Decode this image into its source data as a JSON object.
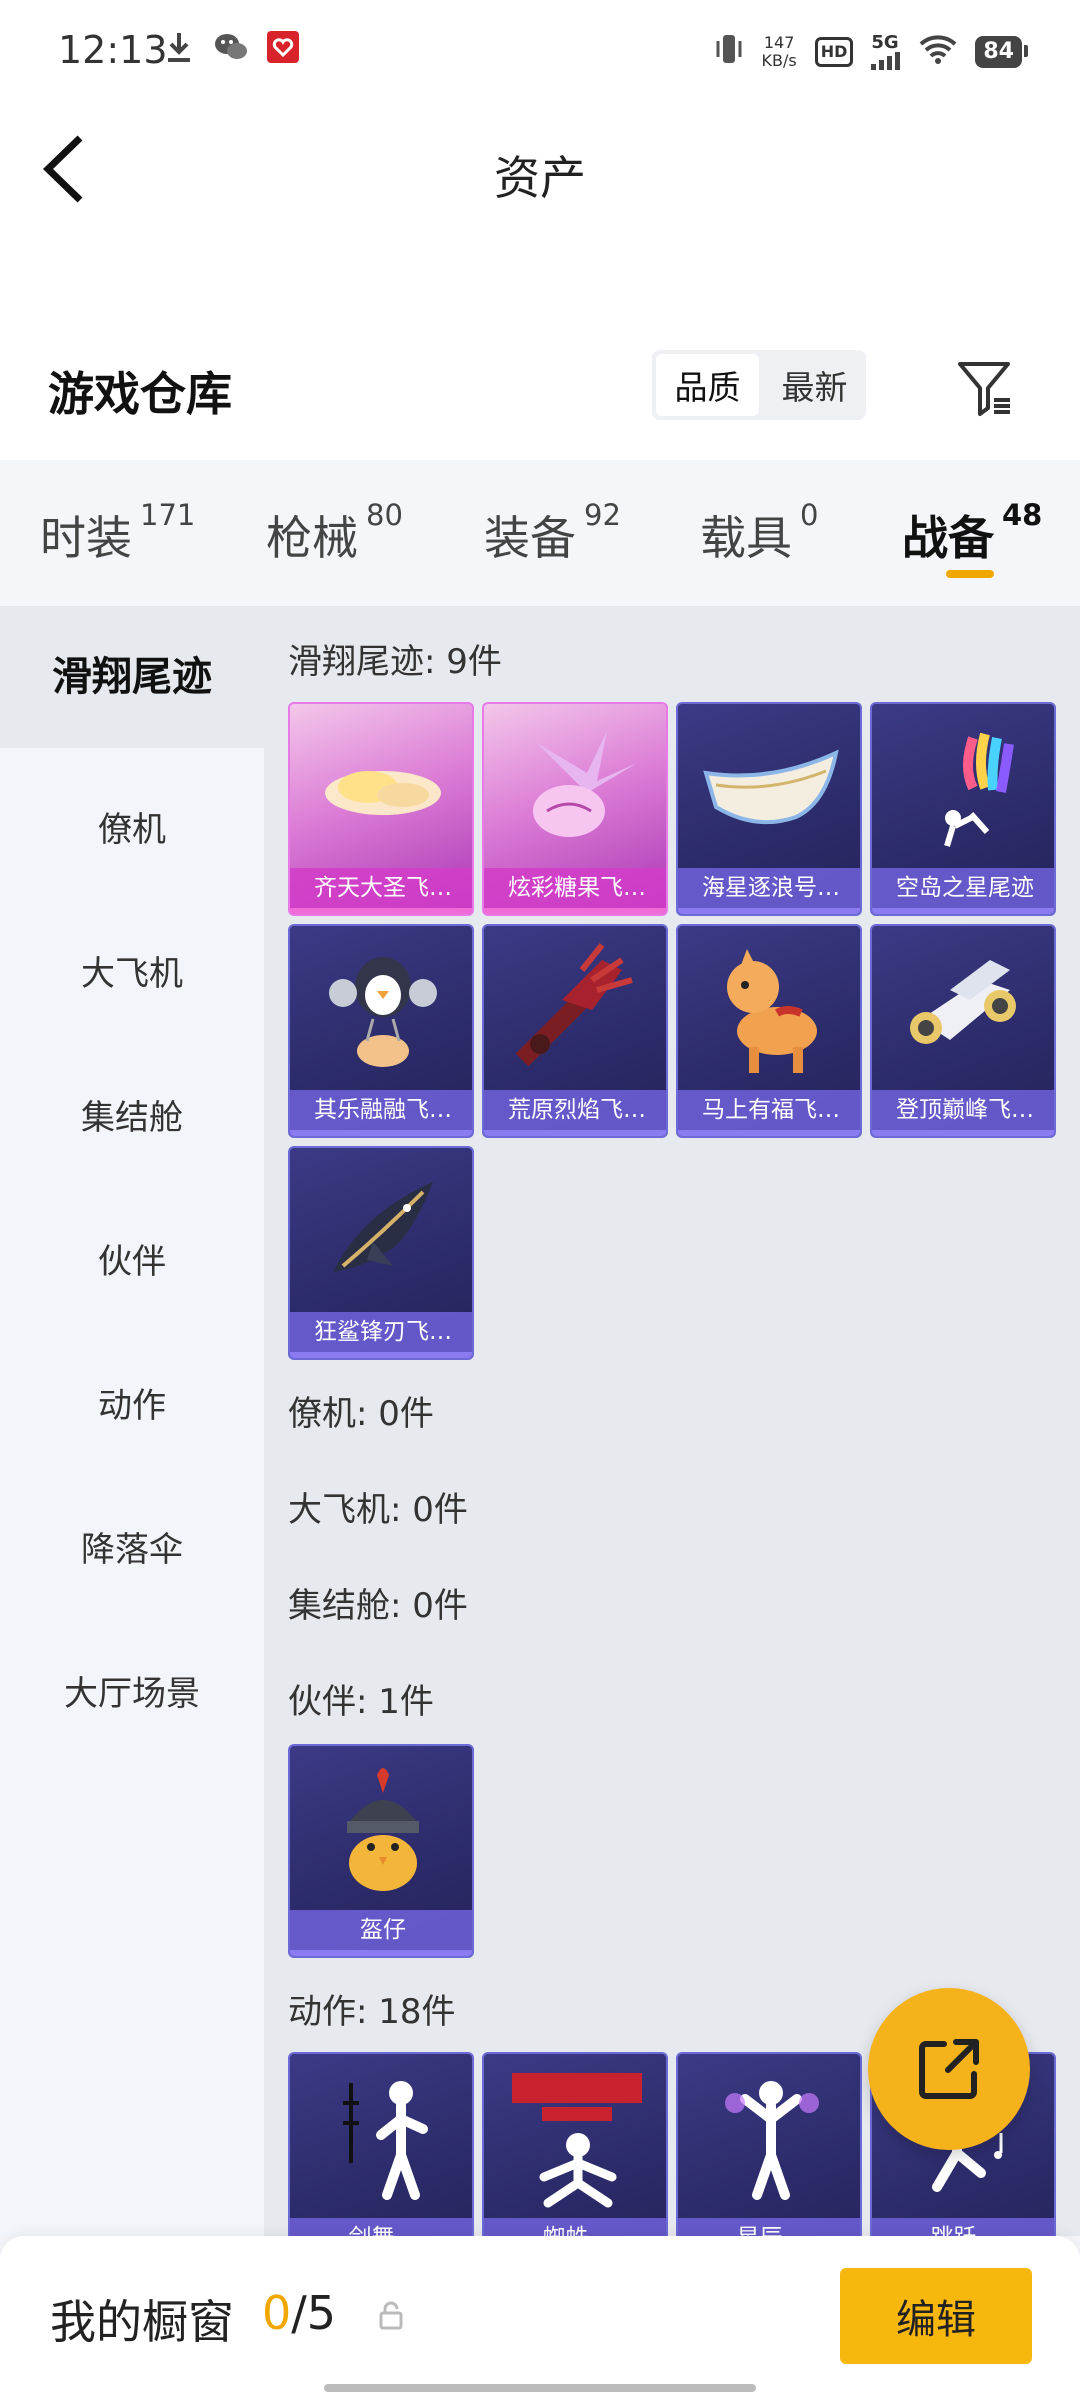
{
  "status_bar": {
    "time": "12:13",
    "net_speed_value": "147",
    "net_speed_unit": "KB/s",
    "hd": "HD",
    "network": "5G",
    "battery": "84"
  },
  "header": {
    "title": "资产"
  },
  "warehouse": {
    "title": "游戏仓库",
    "sort_options": [
      "品质",
      "最新"
    ],
    "selected_sort": "品质"
  },
  "categories": [
    {
      "label": "时装",
      "count": "171"
    },
    {
      "label": "枪械",
      "count": "80"
    },
    {
      "label": "装备",
      "count": "92"
    },
    {
      "label": "载具",
      "count": "0"
    },
    {
      "label": "战备",
      "count": "48"
    }
  ],
  "accent_color": "#f0a800",
  "sidebar": {
    "items": [
      "滑翔尾迹",
      "僚机",
      "大飞机",
      "集结舱",
      "伙伴",
      "动作",
      "降落伞",
      "大厅场景"
    ],
    "selected": "滑翔尾迹"
  },
  "sections": {
    "glide": {
      "title": "滑翔尾迹: 9件",
      "items": [
        {
          "name": "齐天大圣飞…",
          "quality": "pink",
          "icon": "golden-cloud-icon"
        },
        {
          "name": "炫彩糖果飞…",
          "quality": "pink",
          "icon": "candy-icon"
        },
        {
          "name": "海星逐浪号…",
          "quality": "purple",
          "icon": "boat-icon"
        },
        {
          "name": "空岛之星尾迹",
          "quality": "purple",
          "icon": "rainbow-smoke-icon"
        },
        {
          "name": "其乐融融飞…",
          "quality": "purple",
          "icon": "penguin-icon"
        },
        {
          "name": "荒原烈焰飞…",
          "quality": "purple",
          "icon": "flame-glider-icon"
        },
        {
          "name": "马上有福飞…",
          "quality": "purple",
          "icon": "horse-icon"
        },
        {
          "name": "登顶巅峰飞…",
          "quality": "purple",
          "icon": "jet-icon"
        },
        {
          "name": "狂鲨锋刃飞…",
          "quality": "purple",
          "icon": "shark-icon"
        }
      ]
    },
    "wingman": {
      "title": "僚机: 0件"
    },
    "plane": {
      "title": "大飞机: 0件"
    },
    "pod": {
      "title": "集结舱: 0件"
    },
    "buddy": {
      "title": "伙伴: 1件",
      "items": [
        {
          "name": "盔仔",
          "quality": "purple",
          "icon": "helmet-chick-icon"
        }
      ]
    },
    "emote": {
      "title": "动作: 18件",
      "items": [
        {
          "name": "剑舞…",
          "quality": "purple",
          "icon": "dancer-icon"
        },
        {
          "name": "蜘蛛…",
          "quality": "purple",
          "icon": "spider-pose-icon"
        },
        {
          "name": "星辰…",
          "quality": "purple",
          "icon": "dancer-icon"
        },
        {
          "name": "跳跃…",
          "quality": "purple",
          "icon": "dancer-icon"
        }
      ]
    }
  },
  "bottom_bar": {
    "label": "我的橱窗",
    "current": "0",
    "total": "/5",
    "edit_label": "编辑"
  }
}
